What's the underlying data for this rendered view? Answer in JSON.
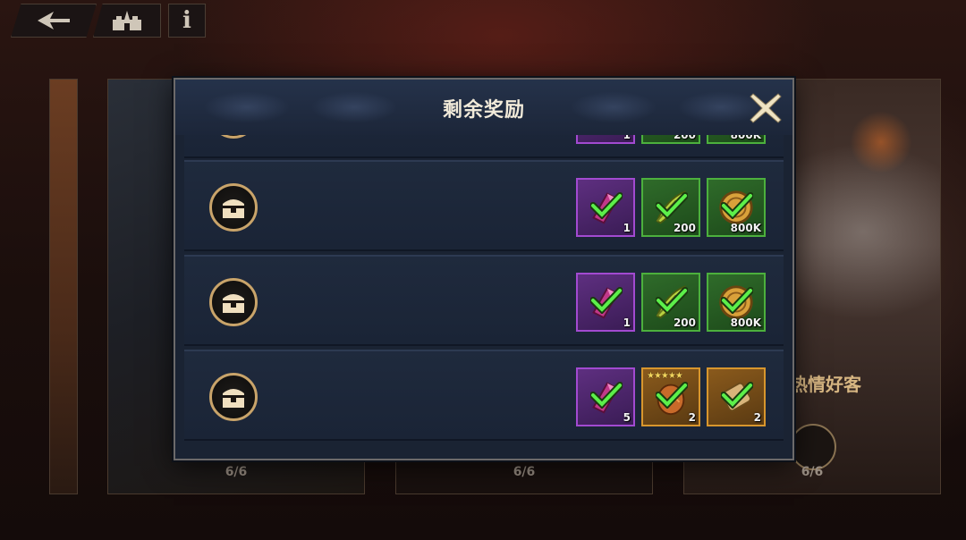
{
  "topbar": {
    "back_icon": "back-arrow-icon",
    "home_icon": "castle-icon",
    "info_label": "i"
  },
  "background_cards": {
    "left_progress": "6/6",
    "middle_progress": "6/6",
    "right_title": "热情好客",
    "right_progress": "6/6"
  },
  "modal": {
    "title": "剩余奖励",
    "close_icon": "close-x-icon",
    "rows": [
      {
        "items": [
          {
            "type": "purple-crystal",
            "rarity": "purple",
            "qty": "1",
            "claimed": true
          },
          {
            "type": "green-feather",
            "rarity": "green",
            "qty": "200",
            "claimed": true
          },
          {
            "type": "gold-coin",
            "rarity": "green",
            "qty": "800K",
            "claimed": true
          }
        ]
      },
      {
        "items": [
          {
            "type": "purple-crystal",
            "rarity": "purple",
            "qty": "1",
            "claimed": true
          },
          {
            "type": "green-feather",
            "rarity": "green",
            "qty": "200",
            "claimed": true
          },
          {
            "type": "gold-coin",
            "rarity": "green",
            "qty": "800K",
            "claimed": true
          }
        ]
      },
      {
        "items": [
          {
            "type": "purple-crystal",
            "rarity": "purple",
            "qty": "1",
            "claimed": true
          },
          {
            "type": "green-feather",
            "rarity": "green",
            "qty": "200",
            "claimed": true
          },
          {
            "type": "gold-coin",
            "rarity": "green",
            "qty": "800K",
            "claimed": true
          }
        ]
      },
      {
        "items": [
          {
            "type": "purple-crystal",
            "rarity": "purple",
            "qty": "5",
            "claimed": true
          },
          {
            "type": "hero-egg",
            "rarity": "orange",
            "qty": "2",
            "stars": "★★★★★",
            "claimed": true
          },
          {
            "type": "scroll",
            "rarity": "orange",
            "qty": "2",
            "claimed": true
          }
        ]
      }
    ]
  },
  "colors": {
    "modal_bg": "#1a2333",
    "title_text": "#f1ead9",
    "chest_border": "#c9a46a",
    "rarity_purple": "#a24ad1",
    "rarity_green": "#4cb03d",
    "rarity_orange": "#d8962d",
    "check_green": "#5cf04a"
  }
}
